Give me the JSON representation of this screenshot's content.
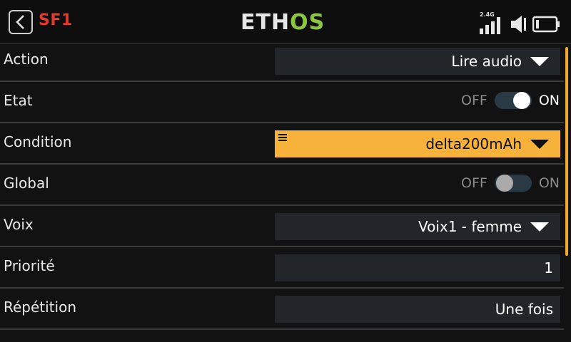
{
  "header": {
    "back_label": "Back",
    "screen_id": "SF1",
    "logo_part1": "ETH",
    "logo_part2": "OS",
    "radio_band": "2.4G"
  },
  "rows": [
    {
      "label": "Action",
      "value": "Lire audio",
      "type": "dropdown"
    },
    {
      "label": "Etat",
      "type": "toggle",
      "off_label": "OFF",
      "on_label": "ON",
      "state": "on"
    },
    {
      "label": "Condition",
      "value": "delta200mAh",
      "type": "dropdown",
      "active": true
    },
    {
      "label": "Global",
      "type": "toggle",
      "off_label": "OFF",
      "on_label": "ON",
      "state": "off"
    },
    {
      "label": "Voix",
      "value": "Voix1 - femme",
      "type": "dropdown"
    },
    {
      "label": "Priorité",
      "value": "1",
      "type": "number"
    },
    {
      "label": "Répétition",
      "value": "Une fois",
      "type": "text"
    }
  ],
  "colors": {
    "accent": "#f7b23b",
    "brand_green": "#8dc63f",
    "screen_id": "#e03a2e"
  },
  "icons": {
    "back": "chevron-left-icon",
    "signal": "signal-strength-icon",
    "audio": "speaker-icon",
    "battery": "battery-icon",
    "menu": "menu-icon",
    "dropdown": "triangle-down-icon"
  }
}
